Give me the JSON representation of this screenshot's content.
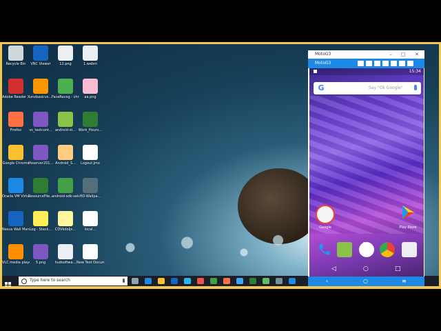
{
  "desktop": {
    "icons": [
      {
        "label": "Recycle Bin",
        "color": "#cfd8dc"
      },
      {
        "label": "VNC Viewer",
        "color": "#1565c0"
      },
      {
        "label": "12.png",
        "color": "#eceff1"
      },
      {
        "label": "1.webm",
        "color": "#eceff1"
      },
      {
        "label": "Adobe Reader XI",
        "color": "#d32f2f"
      },
      {
        "label": "unvbasicvs...",
        "color": "#ff9800"
      },
      {
        "label": "FaceRecog - chrome",
        "color": "#4caf50"
      },
      {
        "label": "aa.png",
        "color": "#f8bbd0"
      },
      {
        "label": "Firefox",
        "color": "#ff7043"
      },
      {
        "label": "vs_testcont...",
        "color": "#7e57c2"
      },
      {
        "label": "android-st...",
        "color": "#8bc34a"
      },
      {
        "label": "Work_Hours...",
        "color": "#2e7d32"
      },
      {
        "label": "Google Chrome",
        "color": "#fbc02d"
      },
      {
        "label": "tfsserver201...",
        "color": "#7e57c2"
      },
      {
        "label": "Android_S...",
        "color": "#ffcc80"
      },
      {
        "label": "Logout.jmx",
        "color": "#ffffff"
      },
      {
        "label": "Oracle VM VirtualBox",
        "color": "#1e88e5"
      },
      {
        "label": "ResourceFile...",
        "color": "#2e7d32"
      },
      {
        "label": "android-sdk-selector",
        "color": "#43a047"
      },
      {
        "label": "HD-Wallpa...",
        "color": "#546e7a"
      },
      {
        "label": "Nexus Wall Manager",
        "color": "#1565c0"
      },
      {
        "label": "Log - Stack...",
        "color": "#ffee58"
      },
      {
        "label": "CDVkdoljx...",
        "color": "#fff59d"
      },
      {
        "label": "local...",
        "color": "#ffffff"
      },
      {
        "label": "VLC media player",
        "color": "#ff8f00"
      },
      {
        "label": "5.png",
        "color": "#7e57c2"
      },
      {
        "label": "hudsoftwa...",
        "color": "#eceff1"
      },
      {
        "label": "New Text Document...",
        "color": "#ffffff"
      }
    ]
  },
  "taskbar": {
    "search_placeholder": "Type here to search",
    "icons": [
      {
        "name": "task-view-icon",
        "color": "#90a4ae"
      },
      {
        "name": "edge-browser-icon",
        "color": "#1e88e5"
      },
      {
        "name": "file-explorer-icon",
        "color": "#fbc02d"
      },
      {
        "name": "outlook-icon",
        "color": "#1565c0"
      },
      {
        "name": "ie-icon",
        "color": "#29b6f6"
      },
      {
        "name": "snipping-tool-icon",
        "color": "#ef5350"
      },
      {
        "name": "chrome-icon",
        "color": "#43a047"
      },
      {
        "name": "firefox-icon",
        "color": "#ff7043"
      },
      {
        "name": "ie-browser-icon",
        "color": "#42a5f5"
      },
      {
        "name": "excel-icon",
        "color": "#2e7d32"
      },
      {
        "name": "android-studio-icon",
        "color": "#66bb6a"
      },
      {
        "name": "monitor-icon",
        "color": "#78909c"
      },
      {
        "name": "app-icon",
        "color": "#1e88e5"
      }
    ]
  },
  "emulator": {
    "window_title": "MotoG3",
    "toolbar_title": "MotoG3",
    "time": "15:34",
    "search_hint": "Say \"Ok Google\"",
    "google_label": "Google",
    "playstore_label": "Play Store",
    "accent": "#1e88e5"
  }
}
